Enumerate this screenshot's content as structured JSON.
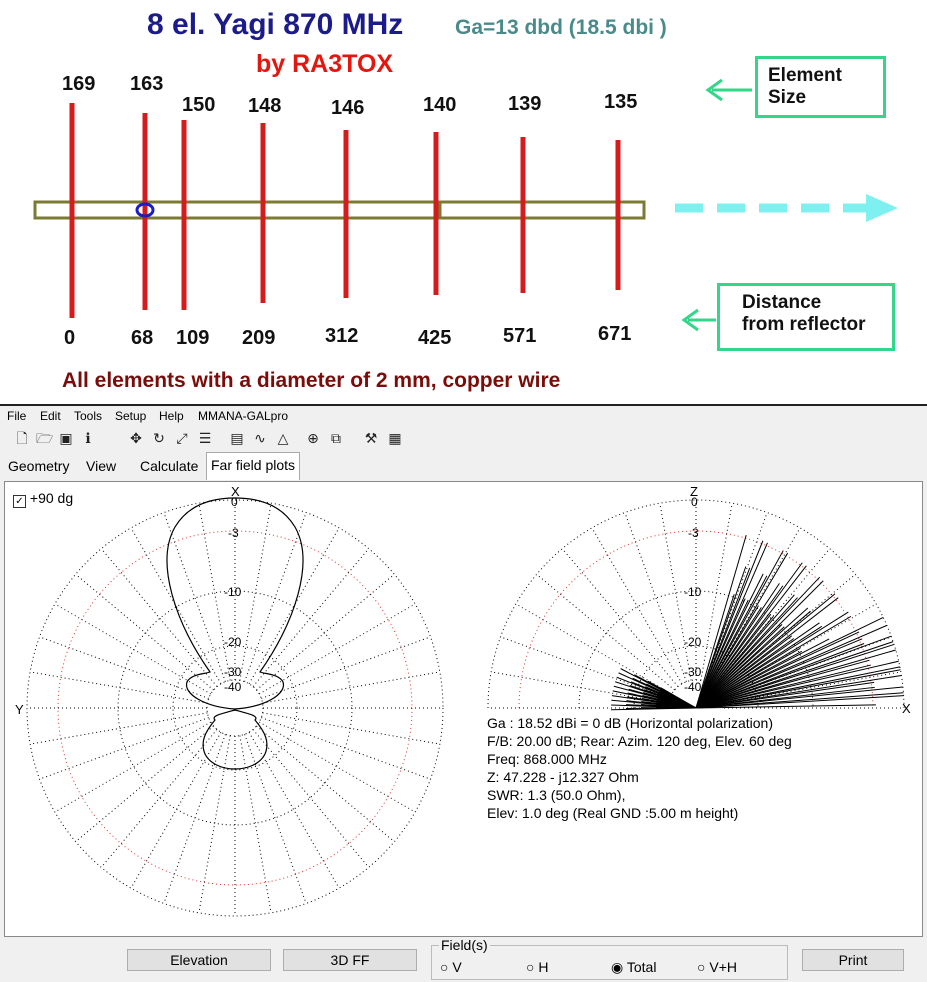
{
  "diagram": {
    "title": "8 el.  Yagi 870 MHz",
    "gain": "Ga=13 dbd  (18.5 dbi )",
    "author": "by RA3TOX",
    "element_sizes": [
      "169",
      "163",
      "150",
      "148",
      "146",
      "140",
      "139",
      "135"
    ],
    "distances": [
      "0",
      "68",
      "109",
      "209",
      "312",
      "425",
      "571",
      "671"
    ],
    "element_size_label": "Element\nSize",
    "distance_label": "Distance\nfrom reflector",
    "note": "All elements with a diameter of 2 mm, copper wire",
    "colors": {
      "element": "#d41c1c",
      "boom": "#7b7b33",
      "arrow": "#7ff0f0",
      "label_border": "#35d68a",
      "title": "#1b1b8a"
    }
  },
  "app": {
    "menu": [
      "File",
      "Edit",
      "Tools",
      "Setup",
      "Help",
      "MMANA-GALpro"
    ],
    "toolbar_icons": [
      "new-file-icon",
      "open-folder-icon",
      "save-icon",
      "info-icon",
      "move-icon",
      "rotate-icon",
      "resize-icon",
      "wire-list-icon",
      "document-icon",
      "curve-icon",
      "triangle-icon",
      "target-icon",
      "copy-icon",
      "tools-icon",
      "calculator-icon"
    ],
    "tabs": [
      "Geometry",
      "View",
      "Calculate",
      "Far field plots"
    ],
    "active_tab": "Far field plots",
    "checkbox_label": "+90 dg",
    "left_plot": {
      "top_axis": "X",
      "side_axis": "Y",
      "ring_labels": [
        "0",
        "-3",
        "-10",
        "-20",
        "-30",
        "-40"
      ]
    },
    "right_plot": {
      "top_axis": "Z",
      "side_axis": "X",
      "ring_labels": [
        "0",
        "-3",
        "-10",
        "-20",
        "-30",
        "-40"
      ]
    },
    "info": [
      "Ga : 18.52 dBi = 0 dB  (Horizontal polarization)",
      "F/B: 20.00 dB; Rear: Azim. 120 deg,  Elev. 60 deg",
      "Freq: 868.000 MHz",
      "Z: 47.228 - j12.327 Ohm",
      "SWR: 1.3 (50.0 Ohm),",
      "Elev: 1.0 deg (Real GND  :5.00 m height)"
    ],
    "buttons": {
      "elevation": "Elevation",
      "ff3d": "3D FF",
      "print": "Print"
    },
    "field_group": {
      "label": "Field(s)",
      "options": [
        "V",
        "H",
        "Total",
        "V+H"
      ],
      "selected": "Total"
    }
  }
}
